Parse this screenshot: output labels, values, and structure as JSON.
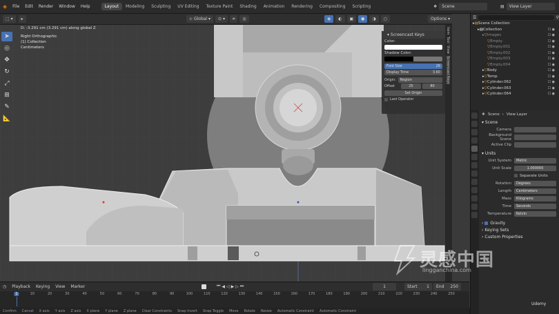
{
  "topbar": {
    "menus": [
      "File",
      "Edit",
      "Render",
      "Window",
      "Help"
    ],
    "workspaces": [
      "Layout",
      "Modeling",
      "Sculpting",
      "UV Editing",
      "Texture Paint",
      "Shading",
      "Animation",
      "Rendering",
      "Compositing",
      "Scripting"
    ],
    "active_workspace": "Layout",
    "scene": "Scene",
    "view_layer": "View Layer"
  },
  "viewport_header": {
    "transform": "Global",
    "options": "Options"
  },
  "viewport": {
    "info_line": "D: -3.291 cm (3.291 cm) along global Z",
    "view_name": "Right Orthographic",
    "collection": "(1) Collection",
    "units": "Centimeters"
  },
  "screencast": {
    "title": "Screencast Keys",
    "color_label": "Color:",
    "shadow_label": "Shadow Color:",
    "font_size_label": "Font Size",
    "font_size_value": "28",
    "display_time_label": "Display Time",
    "display_time_value": "3.60",
    "origin_label": "Origin:",
    "origin_value": "Region",
    "offset_label": "Offset",
    "offset_x": "25",
    "offset_y": "80",
    "set_origin": "Set Origin",
    "last_operator": "Last Operator"
  },
  "side_tabs": [
    "Item",
    "Tool",
    "View",
    "Screencast Keys"
  ],
  "timeline": {
    "menus": [
      "Playback",
      "Keying",
      "View",
      "Marker"
    ],
    "current_frame": "1",
    "start_label": "Start",
    "start": "1",
    "end_label": "End",
    "end": "250",
    "ruler": [
      "1",
      "10",
      "20",
      "30",
      "40",
      "50",
      "60",
      "70",
      "80",
      "90",
      "100",
      "110",
      "120",
      "130",
      "140",
      "150",
      "160",
      "170",
      "180",
      "190",
      "200",
      "210",
      "220",
      "230",
      "240",
      "250"
    ]
  },
  "statusbar": [
    "Confirm",
    "Cancel",
    "X axis",
    "Y axis",
    "Z axis",
    "X plane",
    "Y plane",
    "Z plane",
    "Clear Constraints",
    "Snap Invert",
    "Snap Toggle",
    "Move",
    "Rotate",
    "Resize",
    "Automatic Constraint",
    "Automatic Constraint"
  ],
  "outliner": {
    "items": [
      {
        "name": "Scene Collection",
        "indent": 0,
        "dim": false
      },
      {
        "name": "Collection",
        "indent": 1,
        "dim": false
      },
      {
        "name": "Images",
        "indent": 2,
        "dim": true
      },
      {
        "name": "Empty",
        "indent": 3,
        "dim": true
      },
      {
        "name": "Empty.001",
        "indent": 3,
        "dim": true
      },
      {
        "name": "Empty.002",
        "indent": 3,
        "dim": true
      },
      {
        "name": "Empty.003",
        "indent": 3,
        "dim": true
      },
      {
        "name": "Empty.004",
        "indent": 3,
        "dim": true
      },
      {
        "name": "Body",
        "indent": 2,
        "dim": false
      },
      {
        "name": "Temp",
        "indent": 2,
        "dim": false
      },
      {
        "name": "Cylinder.062",
        "indent": 2,
        "dim": false
      },
      {
        "name": "Cylinder.063",
        "indent": 2,
        "dim": false
      },
      {
        "name": "Cylinder.064",
        "indent": 2,
        "dim": false
      }
    ]
  },
  "properties": {
    "scene_label": "Scene",
    "view_layer_label": "View Layer",
    "section_scene": "Scene",
    "camera_label": "Camera",
    "background_scene_label": "Background Scene",
    "active_clip_label": "Active Clip",
    "section_units": "Units",
    "unit_system_label": "Unit System",
    "unit_system": "Metric",
    "unit_scale_label": "Unit Scale",
    "unit_scale": "1.000000",
    "separate_units": "Separate Units",
    "rotation_label": "Rotation",
    "rotation": "Degrees",
    "length_label": "Length",
    "length": "Centimeters",
    "mass_label": "Mass",
    "mass": "Kilograms",
    "time_label": "Time",
    "time": "Seconds",
    "temperature_label": "Temperature",
    "temperature": "Kelvin",
    "gravity": "Gravity",
    "keying_sets": "Keying Sets",
    "custom_properties": "Custom Properties"
  },
  "watermark": {
    "cn": "灵感中国",
    "url": "lingganchina.com",
    "udemy": "Udemy"
  }
}
